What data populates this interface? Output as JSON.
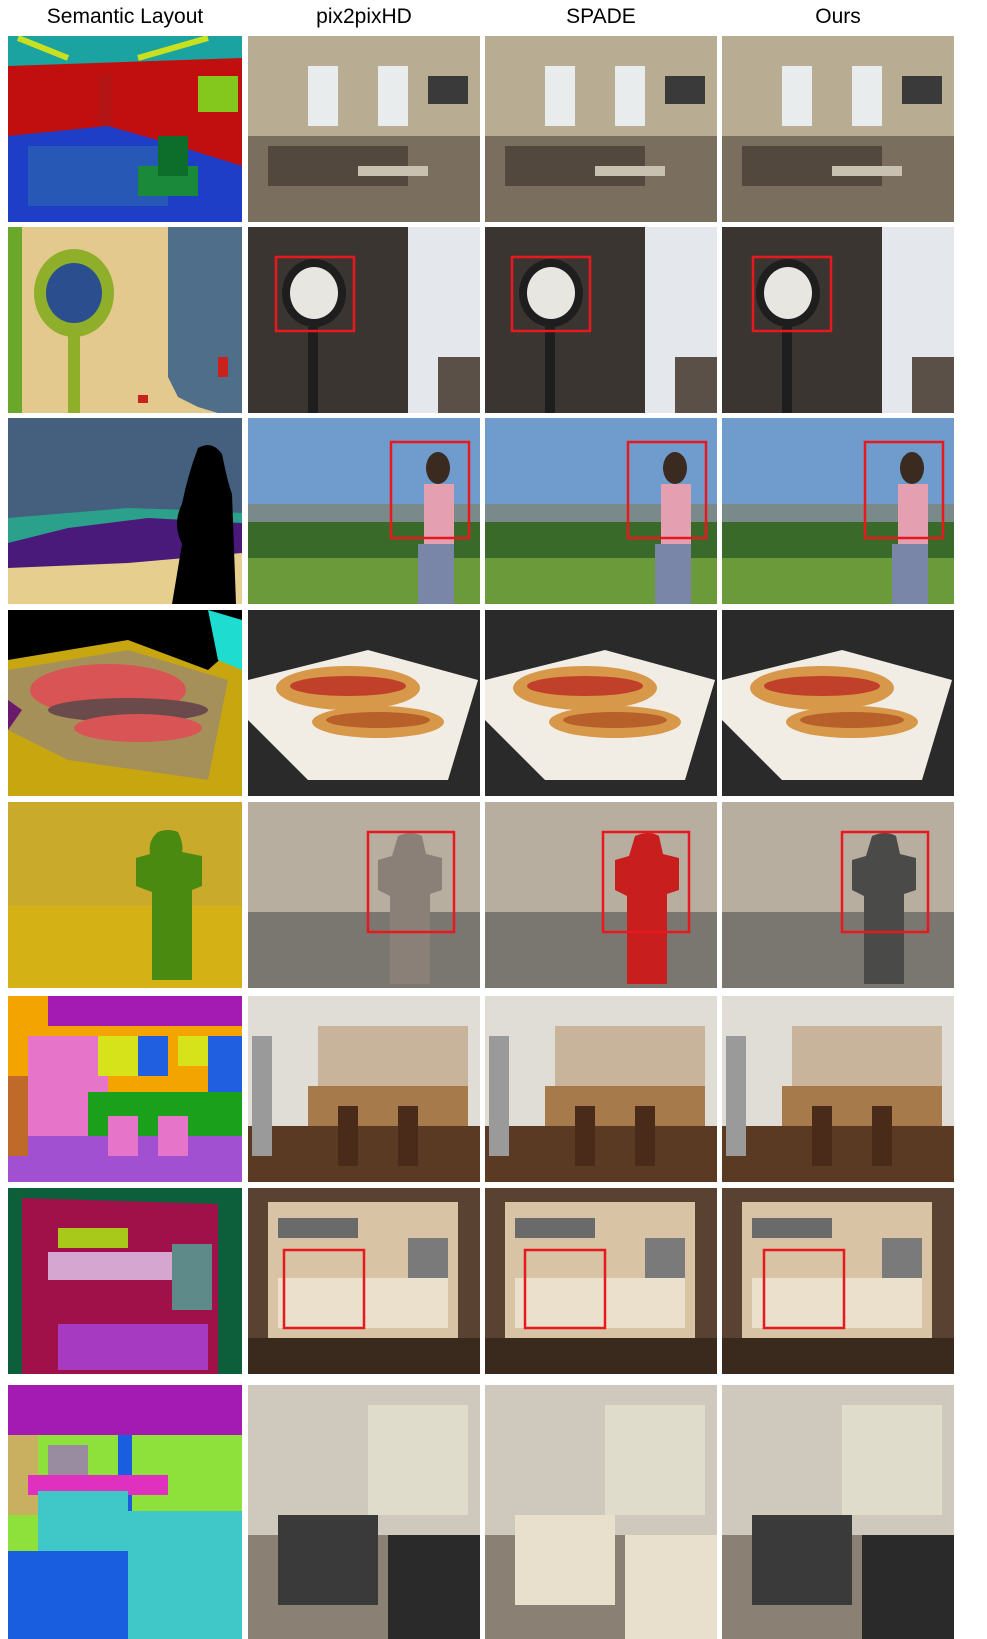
{
  "headers": [
    "Semantic Layout",
    "pix2pixHD",
    "SPADE",
    "Ours"
  ],
  "rows": [
    {
      "subject": "meeting room with chairs",
      "highlight": false
    },
    {
      "subject": "street clock",
      "highlight": true
    },
    {
      "subject": "person with phone on hill",
      "highlight": true
    },
    {
      "subject": "hot dogs on paper",
      "highlight": false
    },
    {
      "subject": "fire hydrant",
      "highlight": true
    },
    {
      "subject": "kitchen with stools",
      "highlight": false
    },
    {
      "subject": "kitchen cabinets",
      "highlight": true
    },
    {
      "subject": "living room",
      "highlight": false
    }
  ],
  "colors": {
    "highlight_box": "#e8191e"
  }
}
